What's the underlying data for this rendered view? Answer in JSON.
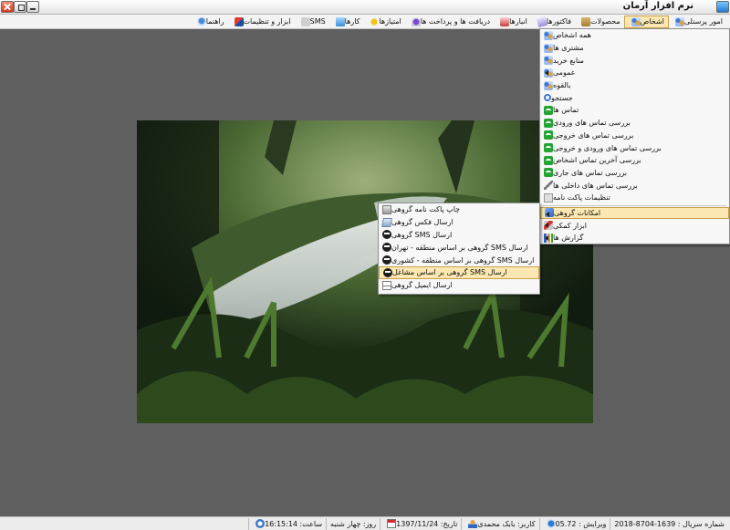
{
  "window": {
    "title": "نرم افزار آرمان"
  },
  "menubar": [
    {
      "label": "امور پرسنلی",
      "icon": "people-icon"
    },
    {
      "label": "اشخاص",
      "icon": "people-icon",
      "active": true
    },
    {
      "label": "محصولات",
      "icon": "product-icon"
    },
    {
      "label": "فاکتورها",
      "icon": "invoice-icon"
    },
    {
      "label": "انبارها",
      "icon": "warehouse-icon"
    },
    {
      "label": "دریافت ها و پرداخت ها",
      "icon": "money-icon"
    },
    {
      "label": "امتیازها",
      "icon": "star-icon"
    },
    {
      "label": "کارها",
      "icon": "cards-icon"
    },
    {
      "label": "SMS",
      "icon": "sms-icon"
    },
    {
      "label": "ابزار و تنظیمات",
      "icon": "tools-icon"
    },
    {
      "label": "راهنما",
      "icon": "help-icon"
    }
  ],
  "persons_menu": {
    "items": [
      {
        "label": "همه اشخاص",
        "icon": "people-icon"
      },
      {
        "label": "مشتری ها",
        "icon": "people-icon"
      },
      {
        "label": "منابع خرید",
        "icon": "people-icon"
      },
      {
        "label": "عمومی",
        "icon": "people-icon",
        "submenu": true
      },
      {
        "label": "بالقوه",
        "icon": "people-icon"
      },
      {
        "label": "جستجو",
        "icon": "search-icon"
      },
      {
        "label": "تماس ها",
        "icon": "phone-icon"
      },
      {
        "label": "بررسی تماس های ورودی",
        "icon": "phone-icon"
      },
      {
        "label": "بررسی تماس های خروجی",
        "icon": "phone-icon"
      },
      {
        "label": "بررسی تماس های ورودی و خروجی",
        "icon": "phone-icon"
      },
      {
        "label": "بررسی آخرین تماس اشخاص",
        "icon": "phone-icon"
      },
      {
        "label": "بررسی تماس های جاری",
        "icon": "phone-icon"
      },
      {
        "label": "بررسی تماس های داخلی ها",
        "icon": "pen-icon"
      },
      {
        "label": "تنظیمات پاکت نامه",
        "icon": "envelope-gray-icon"
      },
      {
        "label": "امکانات گروهی",
        "icon": "group-tools-icon",
        "submenu": true,
        "highlight": true
      },
      {
        "label": "ابزار کمکی",
        "icon": "wrench-icon",
        "submenu": true
      },
      {
        "label": "گزارش ها",
        "icon": "report-icon",
        "submenu": true
      }
    ]
  },
  "group_submenu": {
    "items": [
      {
        "label": "چاپ پاکت نامه گروهی",
        "icon": "print-icon"
      },
      {
        "label": "ارسال فکس گروهی",
        "icon": "fax-icon"
      },
      {
        "label": "ارسال SMS گروهی",
        "icon": "chat-icon"
      },
      {
        "label": "ارسال SMS گروهی بر اساس منطقه - تهران",
        "icon": "chat-icon"
      },
      {
        "label": "ارسال SMS گروهی بر اساس منطقه - کشوری",
        "icon": "chat-icon"
      },
      {
        "label": "ارسال SMS گروهی بر اساس مشاغل",
        "icon": "chat-icon",
        "highlight": true
      },
      {
        "label": "ارسال ایمیل گروهی",
        "icon": "envelope-icon"
      }
    ]
  },
  "statusbar": {
    "serial": "شماره سریال : 1639-8704-2018",
    "version": "ویرایش : 05.72",
    "user": "کاربر: بابک محمدی",
    "date": "تاریخ: 1397/11/24",
    "day": "روز: چهار شنبه",
    "time": "ساعت: 16:15:14"
  }
}
